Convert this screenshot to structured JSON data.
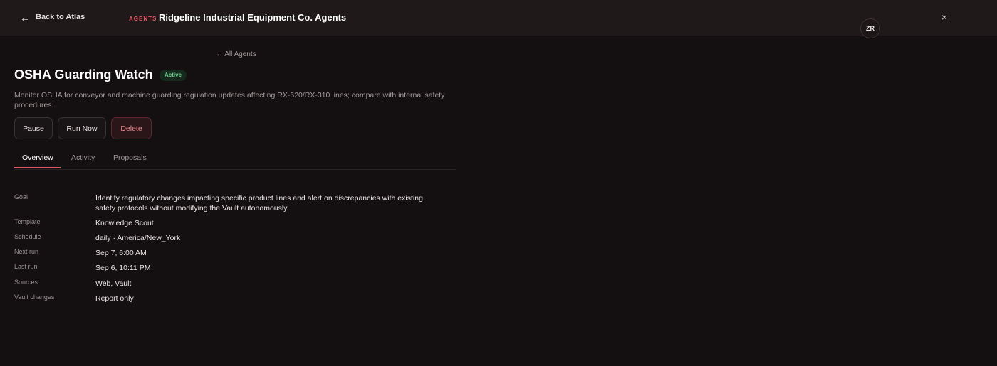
{
  "topbar": {
    "back_label": "Back to Atlas",
    "section_tag": "AGENTS",
    "org_title": "Ridgeline Industrial Equipment Co. Agents",
    "avatar_initials": "ZR",
    "close_icon": "×"
  },
  "nav": {
    "all_agents_label": "← All Agents"
  },
  "agent": {
    "name": "OSHA Guarding Watch",
    "status": "Active",
    "description": "Monitor OSHA for conveyor and machine guarding regulation updates affecting RX-620/RX-310 lines; compare with internal safety procedures."
  },
  "actions": {
    "pause": "Pause",
    "run_now": "Run Now",
    "delete": "Delete"
  },
  "tabs": [
    {
      "label": "Overview",
      "active": true
    },
    {
      "label": "Activity",
      "active": false
    },
    {
      "label": "Proposals",
      "active": false
    }
  ],
  "details": [
    {
      "label": "Goal",
      "value": "Identify regulatory changes impacting specific product lines and alert on discrepancies with existing safety protocols without modifying the Vault autonomously."
    },
    {
      "label": "Template",
      "value": "Knowledge Scout"
    },
    {
      "label": "Schedule",
      "value": "daily · America/New_York"
    },
    {
      "label": "Next run",
      "value": "Sep 7, 6:00 AM"
    },
    {
      "label": "Last run",
      "value": "Sep 6, 10:11 PM"
    },
    {
      "label": "Sources",
      "value": "Web, Vault"
    },
    {
      "label": "Vault changes",
      "value": "Report only"
    }
  ],
  "colors": {
    "accent": "#e05a63",
    "status_active": "#6fd38f",
    "background": "#140f10",
    "topbar": "#1f191a"
  }
}
